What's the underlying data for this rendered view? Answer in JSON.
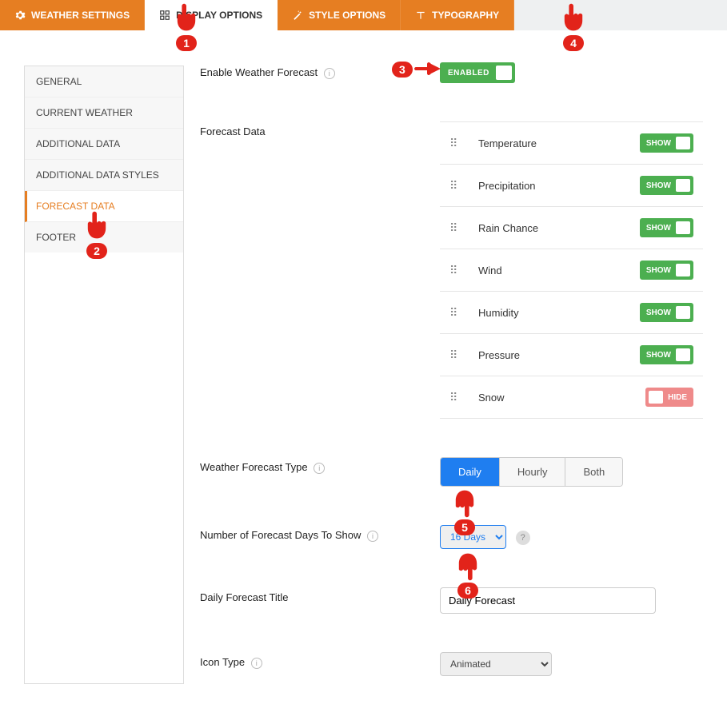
{
  "tabs": [
    {
      "label": "WEATHER SETTINGS",
      "icon": "gear"
    },
    {
      "label": "DISPLAY OPTIONS",
      "icon": "grid",
      "active": true
    },
    {
      "label": "STYLE OPTIONS",
      "icon": "wand"
    },
    {
      "label": "TYPOGRAPHY",
      "icon": "type"
    }
  ],
  "sidebar": [
    {
      "label": "GENERAL"
    },
    {
      "label": "CURRENT WEATHER"
    },
    {
      "label": "ADDITIONAL DATA"
    },
    {
      "label": "ADDITIONAL DATA STYLES"
    },
    {
      "label": "FORECAST DATA",
      "active": true
    },
    {
      "label": "FOOTER"
    }
  ],
  "enable_forecast": {
    "label": "Enable Weather Forecast",
    "toggle": "ENABLED"
  },
  "forecast_data": {
    "label": "Forecast Data",
    "items": [
      {
        "name": "Temperature",
        "state": "SHOW"
      },
      {
        "name": "Precipitation",
        "state": "SHOW"
      },
      {
        "name": "Rain Chance",
        "state": "SHOW"
      },
      {
        "name": "Wind",
        "state": "SHOW"
      },
      {
        "name": "Humidity",
        "state": "SHOW"
      },
      {
        "name": "Pressure",
        "state": "SHOW"
      },
      {
        "name": "Snow",
        "state": "HIDE"
      }
    ]
  },
  "forecast_type": {
    "label": "Weather Forecast Type",
    "options": [
      "Daily",
      "Hourly",
      "Both"
    ],
    "selected": "Daily"
  },
  "days_show": {
    "label": "Number of Forecast Days To Show",
    "value": "16 Days"
  },
  "daily_title": {
    "label": "Daily Forecast Title",
    "value": "Daily Forecast"
  },
  "icon_type": {
    "label": "Icon Type",
    "value": "Animated"
  },
  "pointers": {
    "p1": "1",
    "p2": "2",
    "p3": "3",
    "p4": "4",
    "p5": "5",
    "p6": "6"
  }
}
